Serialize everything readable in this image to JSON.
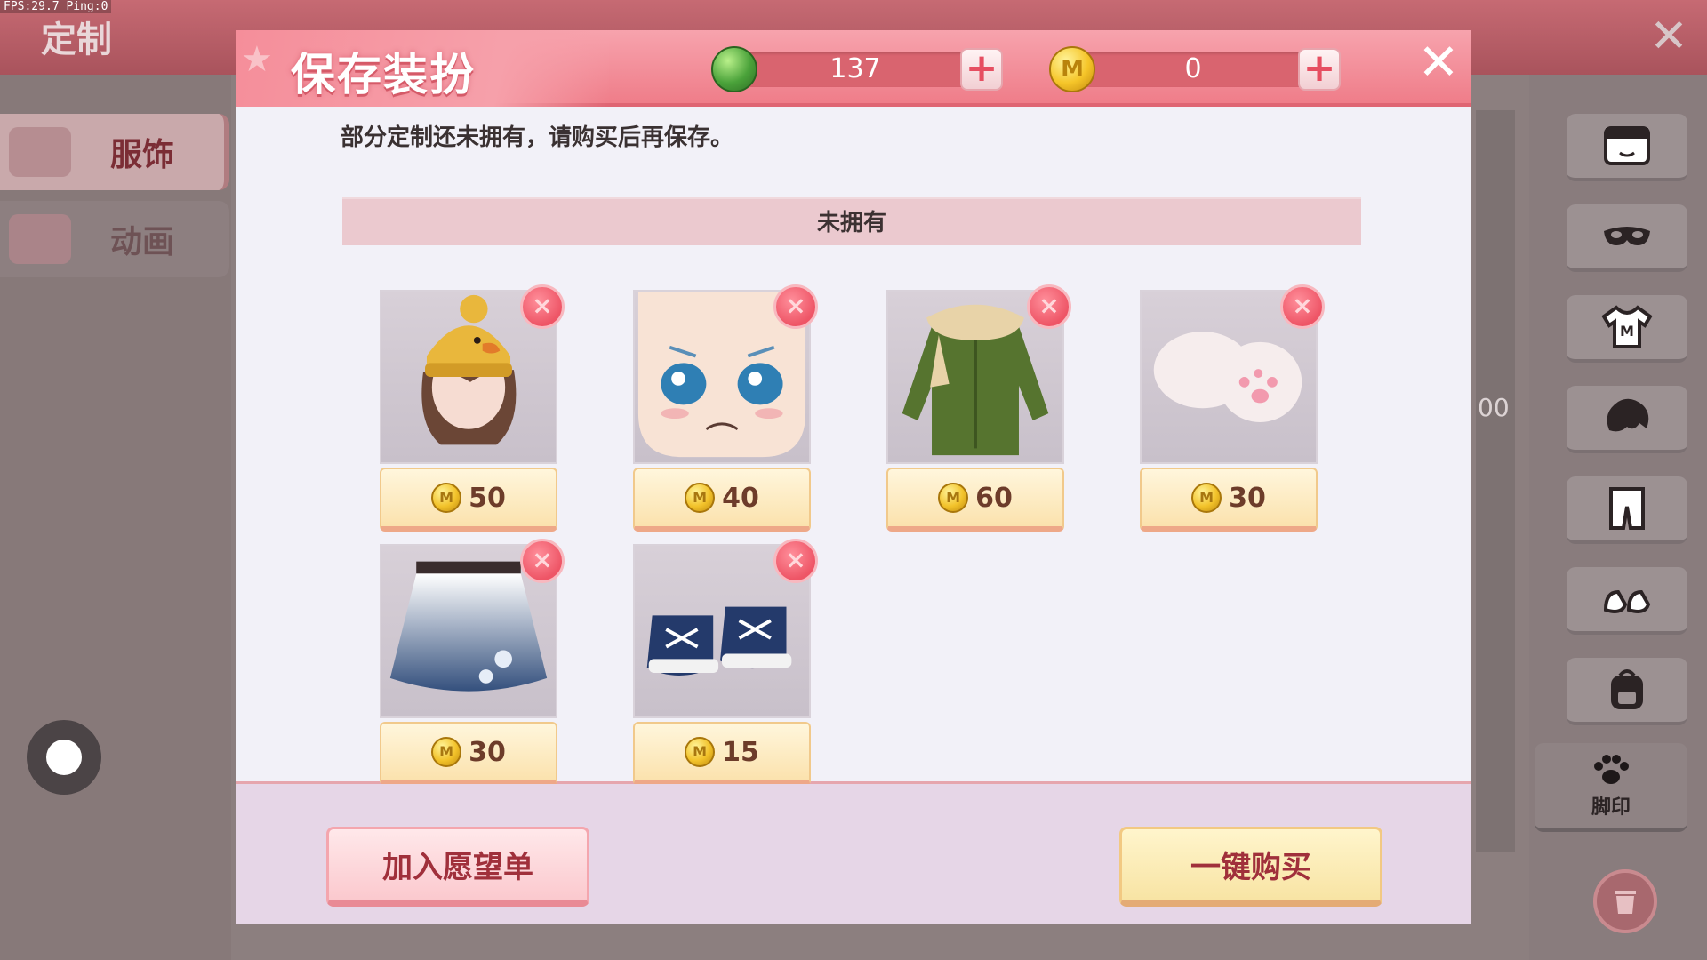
{
  "debug": {
    "fps_text": "FPS:29.7  Ping:0"
  },
  "background": {
    "title": "定制",
    "tabs": [
      {
        "label": "服饰",
        "active": true
      },
      {
        "label": "动画",
        "active": false
      }
    ],
    "right_buttons": [
      "face-icon",
      "mask-icon",
      "shirt-icon",
      "hair-icon",
      "pants-icon",
      "shoes-icon",
      "backpack-icon"
    ],
    "footprint_label": "脚印",
    "partial_number": "00"
  },
  "dialog": {
    "title": "保存装扮",
    "gems": {
      "amount": "137"
    },
    "coins": {
      "amount": "0"
    },
    "notice": "部分定制还未拥有，请购买后再保存。",
    "section_title": "未拥有",
    "items": [
      {
        "name": "duck beanie hair",
        "price": "50"
      },
      {
        "name": "teary face",
        "price": "40"
      },
      {
        "name": "green parka with scarf",
        "price": "60"
      },
      {
        "name": "white paw gloves",
        "price": "30"
      },
      {
        "name": "floral gradient skirt",
        "price": "30"
      },
      {
        "name": "navy sneakers",
        "price": "15"
      }
    ],
    "wishlist_label": "加入愿望单",
    "buy_all_label": "一键购买"
  },
  "colors": {
    "header_pink": "#ef7d89",
    "body_bg": "#f2f1f8",
    "accent_red": "#a0303b",
    "coin_gold": "#f5c529",
    "gem_green": "#4aa23a"
  }
}
